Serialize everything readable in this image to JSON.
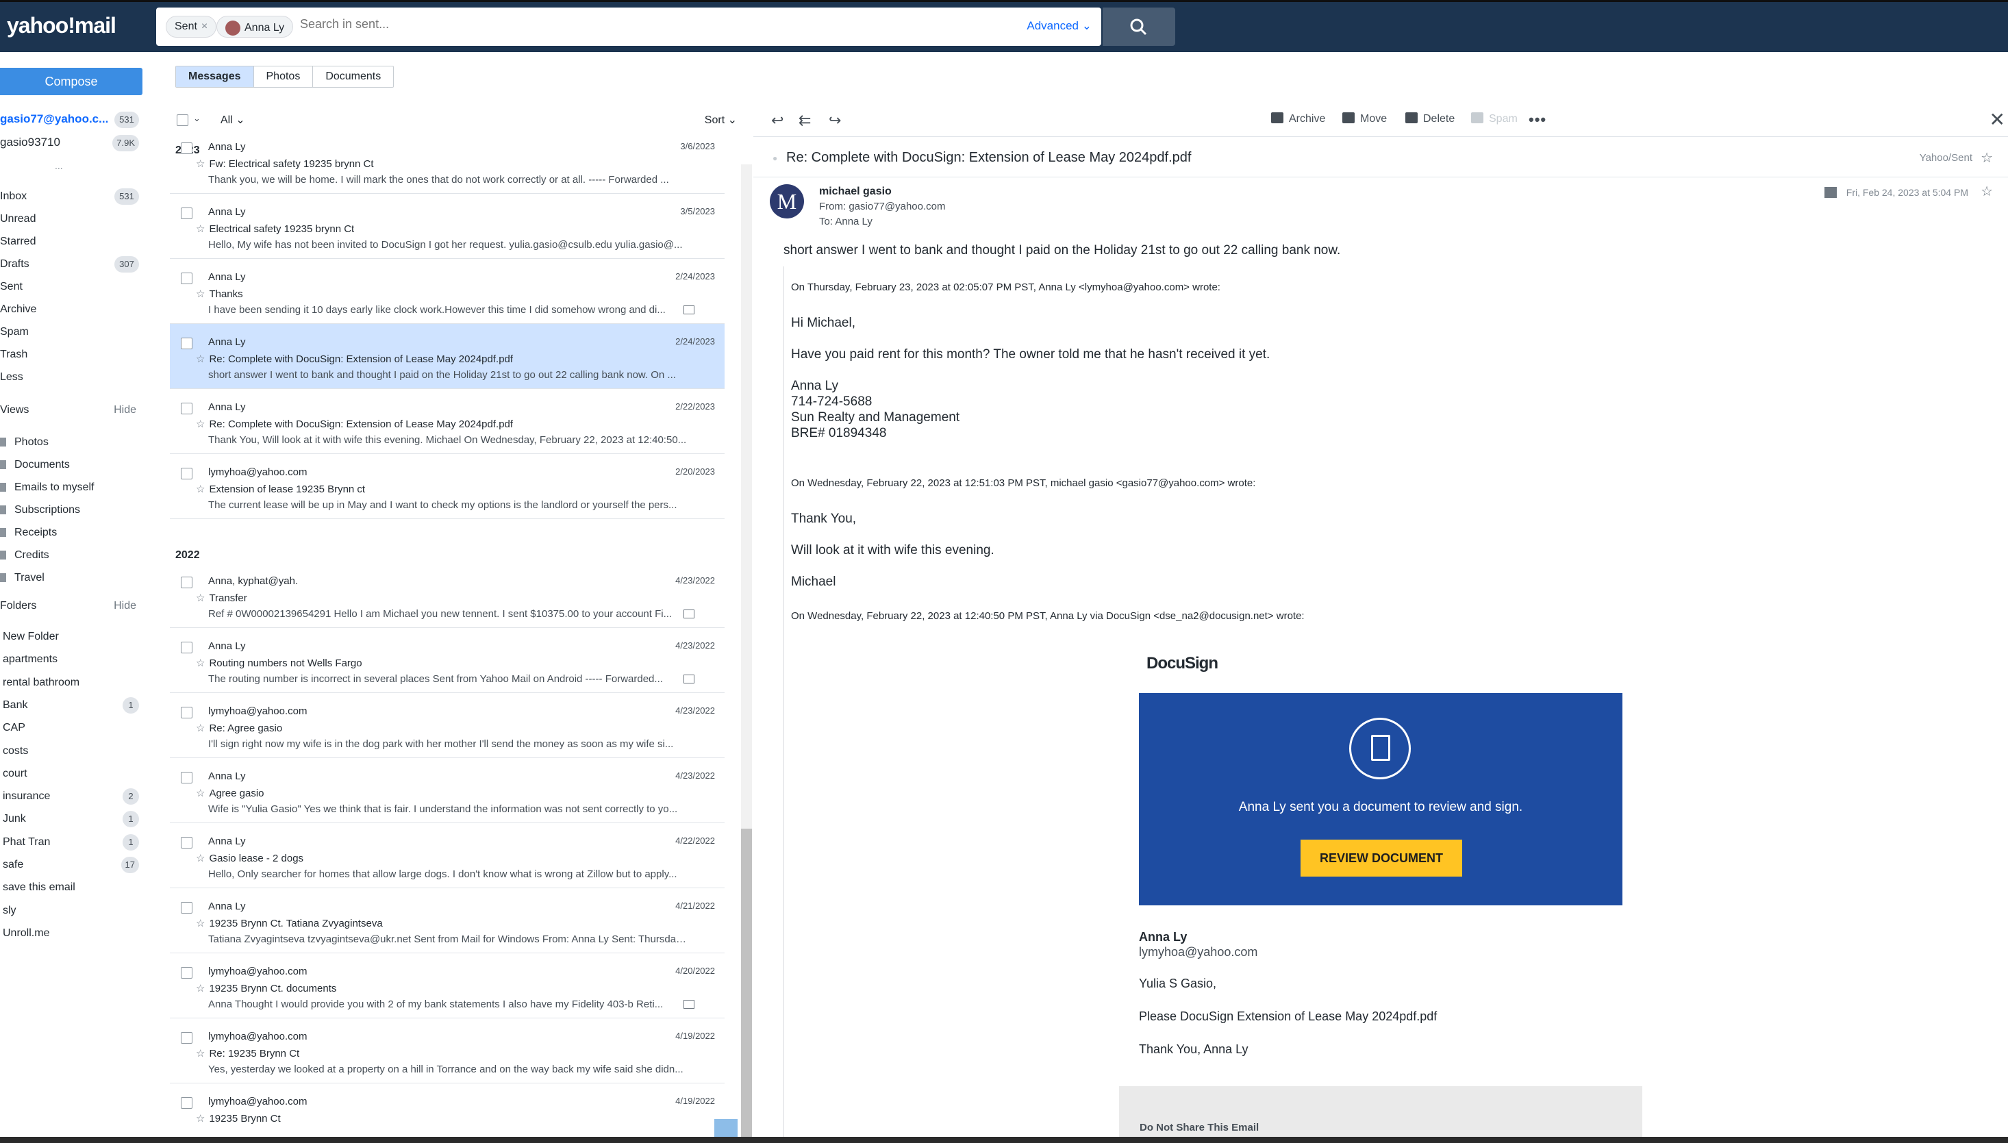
{
  "app": {
    "logo": "yahoo!mail"
  },
  "search": {
    "chip_folder": "Sent",
    "chip_person": "Anna Ly",
    "placeholder": "Search in sent...",
    "advanced_label": "Advanced"
  },
  "sidebar": {
    "compose_label": "Compose",
    "accounts": [
      {
        "label": "gasio77@yahoo.c...",
        "count": "531"
      },
      {
        "label": "gasio93710",
        "count": "7.9K"
      }
    ],
    "more_glyph": "...",
    "items": [
      {
        "label": "Inbox",
        "count": "531"
      },
      {
        "label": "Unread",
        "count": ""
      },
      {
        "label": "Starred",
        "count": ""
      },
      {
        "label": "Drafts",
        "count": "307"
      },
      {
        "label": "Sent",
        "count": ""
      },
      {
        "label": "Archive",
        "count": ""
      },
      {
        "label": "Spam",
        "count": ""
      },
      {
        "label": "Trash",
        "count": ""
      },
      {
        "label": "Less",
        "count": ""
      }
    ],
    "views_title": "Views",
    "views_hide": "Hide",
    "views": [
      "Photos",
      "Documents",
      "Emails to myself",
      "Subscriptions",
      "Receipts",
      "Credits",
      "Travel"
    ],
    "folders_title": "Folders",
    "folders_hide": "Hide",
    "folders": [
      {
        "label": "New Folder",
        "count": ""
      },
      {
        "label": "apartments",
        "count": ""
      },
      {
        "label": "rental bathroom",
        "count": ""
      },
      {
        "label": "Bank",
        "count": "1"
      },
      {
        "label": "CAP",
        "count": ""
      },
      {
        "label": "costs",
        "count": ""
      },
      {
        "label": "court",
        "count": ""
      },
      {
        "label": "insurance",
        "count": "2"
      },
      {
        "label": "Junk",
        "count": "1"
      },
      {
        "label": "Phat Tran",
        "count": "1"
      },
      {
        "label": "safe",
        "count": "17"
      },
      {
        "label": "save this email",
        "count": ""
      },
      {
        "label": "sly",
        "count": ""
      },
      {
        "label": "Unroll.me",
        "count": ""
      }
    ]
  },
  "tabs": [
    "Messages",
    "Photos",
    "Documents"
  ],
  "list_header": {
    "all_label": "All",
    "sort_label": "Sort"
  },
  "years": [
    "2023",
    "2022"
  ],
  "messages": [
    {
      "from": "Anna Ly",
      "date": "3/6/2023",
      "subject": "Fw: Electrical safety 19235 brynn Ct",
      "preview": "Thank you, we will be home. I will mark the ones that do not work correctly or at all. ----- Forwarded ..."
    },
    {
      "from": "Anna Ly",
      "date": "3/5/2023",
      "subject": "Electrical safety 19235 brynn Ct",
      "preview": "Hello, My wife has not been invited to DocuSign I got her request. yulia.gasio@csulb.edu yulia.gasio@..."
    },
    {
      "from": "Anna Ly",
      "date": "2/24/2023",
      "subject": "Thanks",
      "preview": "I have been sending it 10 days early like clock work.However this time I did somehow wrong and di..."
    },
    {
      "from": "Anna Ly",
      "date": "2/24/2023",
      "subject": "Re: Complete with DocuSign: Extension of Lease May 2024pdf.pdf",
      "preview": "short answer I went to bank and thought I paid on the Holiday 21st to go out 22 calling bank now. On ..."
    },
    {
      "from": "Anna Ly",
      "date": "2/22/2023",
      "subject": "Re: Complete with DocuSign: Extension of Lease May 2024pdf.pdf",
      "preview": "Thank You, Will look at it with wife this evening. Michael On Wednesday, February 22, 2023 at 12:40:50..."
    },
    {
      "from": "lymyhoa@yahoo.com",
      "date": "2/20/2023",
      "subject": "Extension of lease 19235 Brynn ct",
      "preview": "The current lease will be up in May and I want to check my options is the landlord or yourself the pers..."
    },
    {
      "from": "Anna, kyphat@yah.",
      "date": "4/23/2022",
      "subject": "Transfer",
      "preview": "Ref # 0W00002139654291 Hello I am Michael you new tennent. I sent $10375.00 to your account Fi..."
    },
    {
      "from": "Anna Ly",
      "date": "4/23/2022",
      "subject": "Routing numbers not Wells Fargo",
      "preview": "The routing number is incorrect in several places Sent from Yahoo Mail on Android ----- Forwarded..."
    },
    {
      "from": "lymyhoa@yahoo.com",
      "date": "4/23/2022",
      "subject": "Re: Agree gasio",
      "preview": "I'll sign right now my wife is in the dog park with her mother I'll send the money as soon as my wife si..."
    },
    {
      "from": "Anna Ly",
      "date": "4/23/2022",
      "subject": "Agree gasio",
      "preview": "Wife is \"Yulia Gasio\" Yes we think that is fair. I understand the information was not sent correctly to yo..."
    },
    {
      "from": "Anna Ly",
      "date": "4/22/2022",
      "subject": "Gasio lease - 2 dogs",
      "preview": "Hello, Only searcher for homes that allow large dogs. I don't know what is wrong at Zillow but to apply..."
    },
    {
      "from": "Anna Ly",
      "date": "4/21/2022",
      "subject": "19235 Brynn Ct. Tatiana Zvyagintseva",
      "preview": "Tatiana Zvyagintseva tzvyagintseva@ukr.net Sent from Mail for Windows From: Anna Ly Sent: Thursday..."
    },
    {
      "from": "lymyhoa@yahoo.com",
      "date": "4/20/2022",
      "subject": "19235 Brynn Ct. documents",
      "preview": "Anna Thought I would provide you with 2 of my bank statements I also have my Fidelity 403-b Reti..."
    },
    {
      "from": "lymyhoa@yahoo.com",
      "date": "4/19/2022",
      "subject": "Re: 19235 Brynn Ct",
      "preview": "Yes, yesterday we looked at a property on a hill in Torrance and on the way back my wife said she didn..."
    },
    {
      "from": "lymyhoa@yahoo.com",
      "date": "4/19/2022",
      "subject": "19235 Brynn Ct",
      "preview": ""
    }
  ],
  "toolbar": {
    "archive": "Archive",
    "move": "Move",
    "delete": "Delete",
    "spam": "Spam"
  },
  "reading": {
    "subject": "Re: Complete with DocuSign: Extension of Lease May 2024pdf.pdf",
    "folder": "Yahoo/Sent",
    "avatar_letter": "M",
    "sender": "michael gasio",
    "from": "From: gasio77@yahoo.com",
    "to": "To: Anna Ly",
    "date": "Fri, Feb 24, 2023 at 5:04 PM",
    "body": "short answer I went to bank and thought I paid on the Holiday 21st to go out 22 calling bank now.",
    "quote1_header": "On Thursday, February 23, 2023 at 02:05:07 PM PST, Anna Ly <lymyhoa@yahoo.com> wrote:",
    "quote1_lines": [
      "Hi Michael,",
      "Have you paid rent for this month? The owner told me that he hasn't received it yet.",
      "Anna Ly",
      "714-724-5688",
      "Sun Realty and Management",
      "BRE# 01894348"
    ],
    "quote2_header": "On Wednesday, February 22, 2023 at 12:51:03 PM PST, michael gasio <gasio77@yahoo.com> wrote:",
    "quote2_lines": [
      "Thank You,",
      "Will look at it with wife this evening.",
      "Michael"
    ],
    "quote3_header": "On Wednesday, February 22, 2023 at 12:40:50 PM PST, Anna Ly via DocuSign <dse_na2@docusign.net> wrote:",
    "docusign": {
      "logo": "DocuSign",
      "message": "Anna Ly sent you a document to review and sign.",
      "button": "REVIEW DOCUMENT",
      "sig_name": "Anna Ly",
      "sig_email": "lymyhoa@yahoo.com",
      "greeting": "Yulia S Gasio,",
      "request": "Please DocuSign Extension of Lease May 2024pdf.pdf",
      "thanks": "Thank You, Anna Ly",
      "footer": "Do Not Share This Email"
    }
  }
}
